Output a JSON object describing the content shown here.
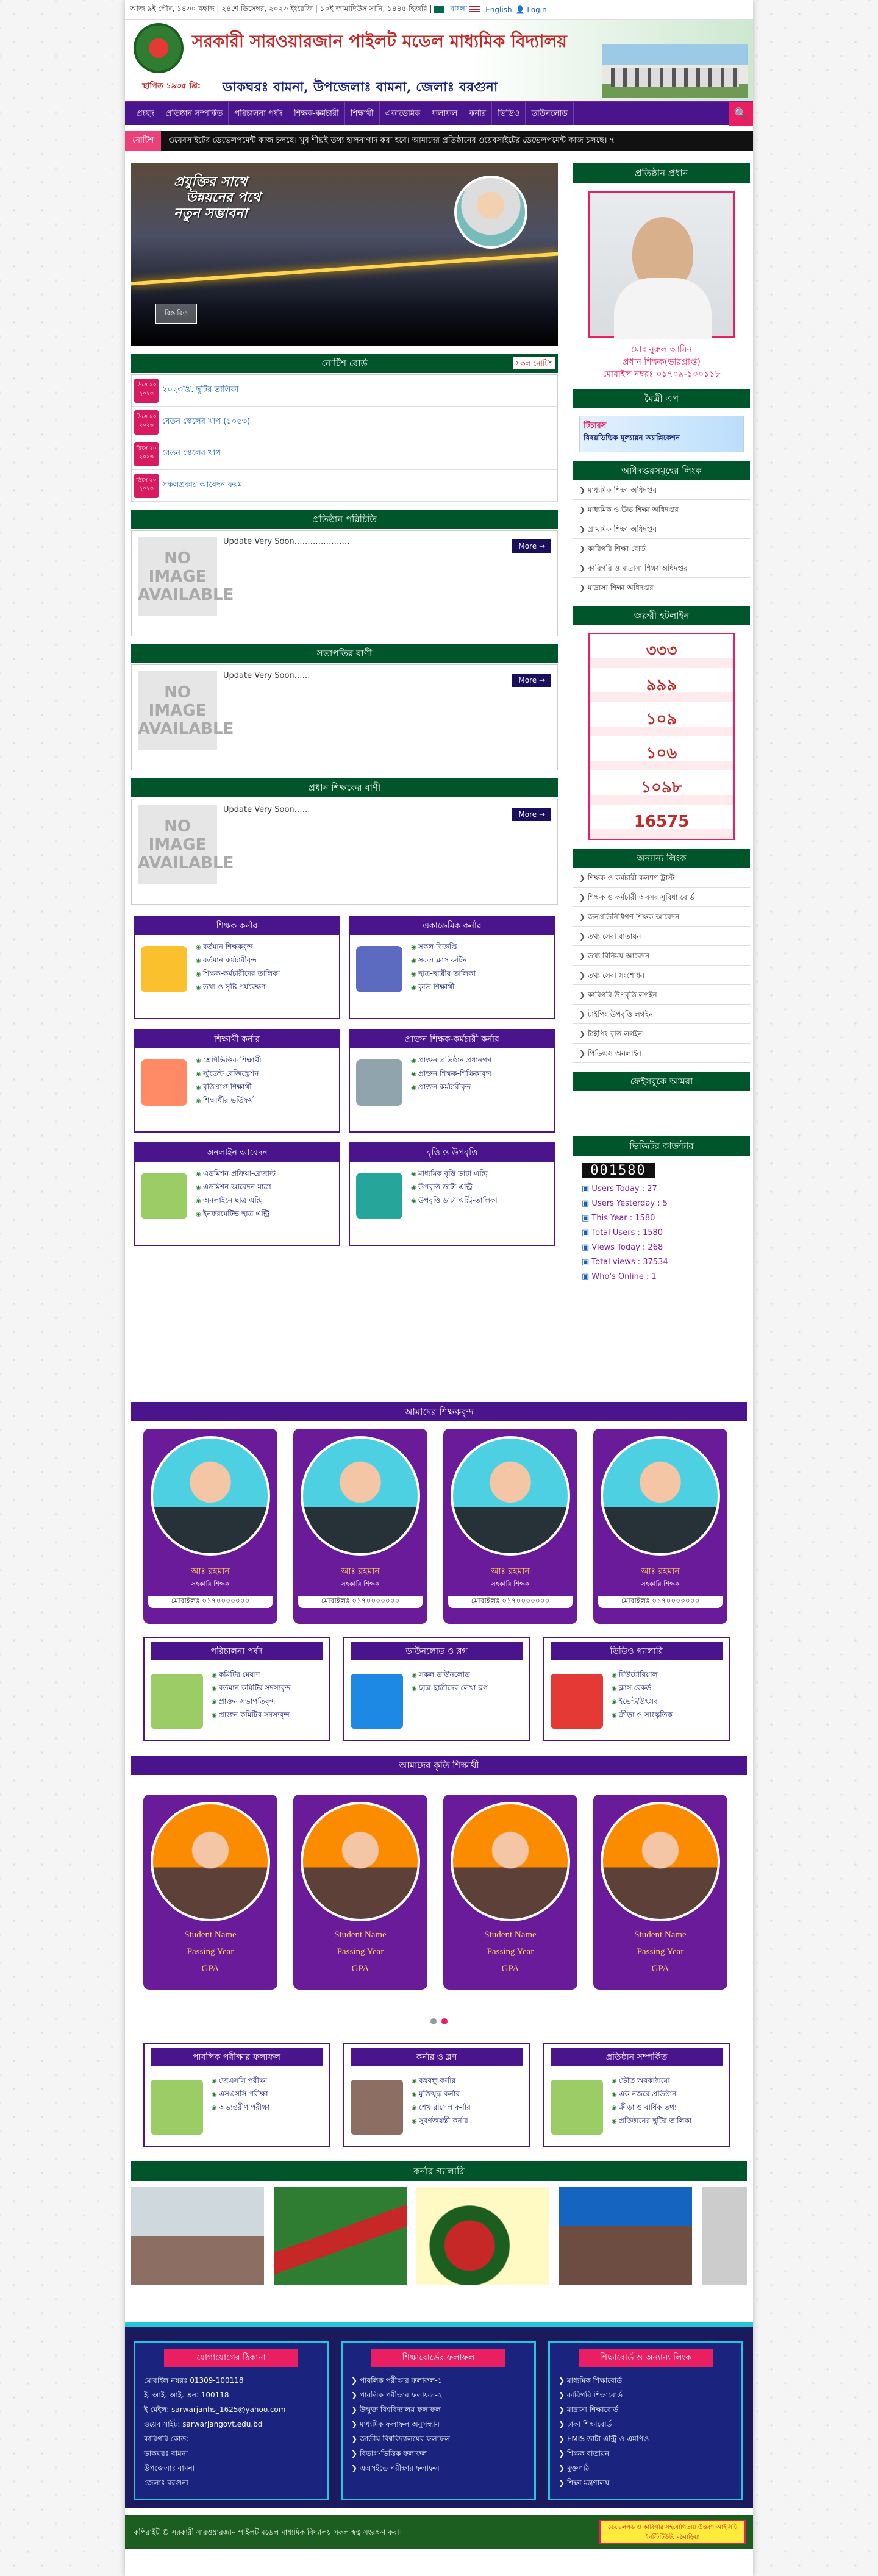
{
  "topbar": {
    "date": "আজ ৯ই পৌষ, ১৪৩০ বঙ্গাব্দ | ২৪শে ডিসেম্বর, ২০২৩ ইংরেজি | ১০ই জামাদিউস সানি, ১৪৪৫ হিজরি |",
    "bangla": "বাংলা",
    "english": "English",
    "login": "Login"
  },
  "header": {
    "title": "সরকারী সারওয়ারজান পাইলট মডেল মাধ্যমিক বিদ্যালয়",
    "est": "স্থাপিত ১৯৩৫ খ্রি:",
    "address": "ডাকঘরঃ বামনা, উপজেলাঃ বামনা, জেলাঃ বরগুনা"
  },
  "nav": [
    "প্রচ্ছদ",
    "প্রতিষ্ঠান সম্পর্কিত",
    "পরিচালনা পর্ষদ",
    "শিক্ষক-কর্মচারী",
    "শিক্ষার্থী",
    "একাডেমিক",
    "ফলাফল",
    "কর্নার",
    "ভিডিও",
    "ডাউনলোড"
  ],
  "notice_label": "নোটিশ",
  "marquee": "ওয়েবসাইটের ডেভেলপমেন্ট কাজ চলছে। খুব শীঘ্রই তথ্য হালনাগাদ করা হবে।   আমাদের প্রতিষ্ঠানের ওয়েবসাইটের ডেভেলপমেন্ট কাজ চলছে। ৭",
  "slider": {
    "caption_1": "প্রযুক্তির সাথে",
    "caption_2": "উন্নয়নের পথে",
    "caption_3": "নতুন সম্ভাবনা",
    "button": "বিস্তারিত"
  },
  "notice_board": {
    "title": "নোটিশ বোর্ড",
    "all": "সকল নোটিশ",
    "items": [
      {
        "date": "ডিসে ২০ ২০২৩",
        "text": "২০২৩খ্রি. ছুটির তালিকা"
      },
      {
        "date": "ডিসে ২০ ২০২৩",
        "text": "বেতন স্কেলের খাপ (১০৫৩)"
      },
      {
        "date": "ডিসে ২০ ২০২৩",
        "text": "বেতন স্কেলের খাপ"
      },
      {
        "date": "ডিসে ২০ ২০২৩",
        "text": "সকলপ্রকার আবেদন ফরম"
      }
    ]
  },
  "sections": [
    {
      "title": "প্রতিষ্ঠান পরিচিতি",
      "text": "Update Very Soon…………………",
      "more": "More →",
      "noimg": "NO IMAGE AVAILABLE"
    },
    {
      "title": "সভাপতির বাণী",
      "text": "Update Very Soon……",
      "more": "More →",
      "noimg": "NO IMAGE AVAILABLE"
    },
    {
      "title": "প্রধান শিক্ষকের বাণী",
      "text": "Update Very Soon……",
      "more": "More →",
      "noimg": "NO IMAGE AVAILABLE"
    }
  ],
  "categories": [
    {
      "title": "শিক্ষক কর্নার",
      "items": [
        "বর্তমান শিক্ষকবৃন্দ",
        "বর্তমান কর্মচারীবৃন্দ",
        "শিক্ষক-কর্মচারীদের তালিকা",
        "তথ্য ও সৃষ্টি পর্যবেক্ষণ"
      ]
    },
    {
      "title": "একাডেমিক কর্নার",
      "items": [
        "সকল বিজ্ঞপ্তি",
        "সকল ক্লাস রুটিন",
        "ছাত্র-ছাত্রীর তালিকা",
        "কৃতি শিক্ষার্থী"
      ]
    },
    {
      "title": "শিক্ষার্থী কর্নার",
      "items": [
        "শ্রেণিভিত্তিক শিক্ষার্থী",
        "স্টুডেন্ট রেজিস্ট্রেশন",
        "বৃত্তিপ্রাপ্ত শিক্ষার্থী",
        "শিক্ষার্থীর ভর্তিফর্ম"
      ]
    },
    {
      "title": "প্রাক্তন শিক্ষক-কর্মচারী কর্নার",
      "items": [
        "প্রাক্তন প্রতিষ্ঠান প্রধানগণ",
        "প্রাক্তন শিক্ষক-শিক্ষিকাবৃন্দ",
        "প্রাক্তন কর্মচারীবৃন্দ"
      ]
    },
    {
      "title": "অনলাইন আবেদন",
      "items": [
        "এডমিশন প্রক্রিয়া-রেজাল্ট",
        "এডমিশন আবেদন-মাত্রা",
        "অনলাইনে ছাত্র এন্ট্রি",
        "ইনফরমেটিভ ছাত্র এন্ট্রি"
      ]
    },
    {
      "title": "বৃত্তি ও উপবৃত্তি",
      "items": [
        "মাধ্যমিক বৃত্তি ডাটা এন্ট্রি",
        "উপবৃত্তি ডাটা এন্ট্রি",
        "উপবৃত্তি ডাটা এন্ট্রি-তালিকা"
      ]
    }
  ],
  "head_teacher": {
    "box": "প্রতিষ্ঠান প্রধান",
    "name": "মোঃ নুরুল আমিন",
    "role": "প্রধান শিক্ষক(ভারপ্রাপ্ত)",
    "mobile": "মোবাইল নম্বরঃ ০১৭০৯-১০০১১৮"
  },
  "app": {
    "box": "মৈত্রী এপ",
    "brand": "টিচারস",
    "text": "বিষয়ভিত্তিক মূল্যায়ন অ্যাপ্লিকেশন"
  },
  "gov_links": {
    "box": "অধিদপ্তরসমূহের লিংক",
    "items": [
      "মাধ্যমিক শিক্ষা অধিদপ্তর",
      "মাধ্যমিক ও উচ্চ শিক্ষা অধিদপ্তর",
      "প্রাথমিক শিক্ষা অধিদপ্তর",
      "কারিগরি শিক্ষা বোর্ড",
      "কারিগরি ও মাদ্রাসা শিক্ষা অধিদপ্তর",
      "মাদ্রাসা শিক্ষা অধিদপ্তর"
    ]
  },
  "hotline": {
    "box": "জরুরী হটলাইন",
    "nums": [
      "৩৩৩",
      "৯৯৯",
      "১০৯",
      "১০৬",
      "১০৯৮",
      "16575"
    ]
  },
  "other_links": {
    "box": "অন্যান্য লিংক",
    "items": [
      "শিক্ষক ও কর্মচারী কল্যাণ ট্রাস্ট",
      "শিক্ষক ও কর্মচারী অবসর সুবিধা বোর্ড",
      "জনপ্রতিনিধিগণ শিক্ষক আবেদন",
      "তথ্য সেবা বাতায়ন",
      "তথ্য বিনিময় আবেদন",
      "তথ্য সেবা সংশোধন",
      "কারিগরি উপবৃত্তি লগইন",
      "টাইপিং উপবৃত্তি লগইন",
      "টাইপিং বৃত্তি লগইন",
      "পিডিএস অনলাইন"
    ]
  },
  "facebook": "ফেইসবুকে আমরা",
  "visitor": {
    "box": "ভিজিটর কাউন্টার",
    "count": "001580",
    "stats": [
      "Users Today : 27",
      "Users Yesterday : 5",
      "This Year : 1580",
      "Total Users : 1580",
      "Views Today : 268",
      "Total views : 37534",
      "Who's Online : 1"
    ]
  },
  "teachers": {
    "title": "আমাদের শিক্ষকবৃন্দ",
    "items": [
      {
        "name": "আঃ রহমান",
        "role": "সহকারি শিক্ষক",
        "mobile": "মোবাইলঃ ০১৭০০০০০০০"
      },
      {
        "name": "আঃ রহমান",
        "role": "সহকারি শিক্ষক",
        "mobile": "মোবাইলঃ ০১৭০০০০০০০"
      },
      {
        "name": "আঃ রহমান",
        "role": "সহকারি শিক্ষক",
        "mobile": "মোবাইলঃ ০১৭০০০০০০০"
      },
      {
        "name": "আঃ রহমান",
        "role": "সহকারি শিক্ষক",
        "mobile": "মোবাইলঃ ০১৭০০০০০০০"
      }
    ]
  },
  "mid_boxes": [
    {
      "title": "পরিচালনা পর্ষদ",
      "items": [
        "কমিটির মেয়াদ",
        "বর্তমান কমিটির সদস্যবৃন্দ",
        "প্রাক্তন সভাপতিবৃন্দ",
        "প্রাক্তন কমিটির সদস্যবৃন্দ"
      ]
    },
    {
      "title": "ডাউনলোড ও ব্লগ",
      "items": [
        "সকল ডাউনলোড",
        "ছাত্র-ছাত্রীদের লেখা ব্লগ"
      ]
    },
    {
      "title": "ভিডিও গ্যালারি",
      "items": [
        "টিউটোরিয়াল",
        "ক্লাস রেকর্ড",
        "ইভেন্ট/উৎসব",
        "ক্রীড়া ও সাংস্কৃতিক"
      ]
    }
  ],
  "students": {
    "title": "আমাদের কৃতি শিক্ষার্থী",
    "name": "Student Name",
    "year": "Passing Year",
    "gpa": "GPA"
  },
  "bottom_boxes": [
    {
      "title": "পাবলিক পরীক্ষার ফলাফল",
      "items": [
        "জেএসসি পরীক্ষা",
        "এসএসসি পরীক্ষা",
        "অভ্যন্তরীণ পরীক্ষা"
      ]
    },
    {
      "title": "কর্নার ও ব্লগ",
      "items": [
        "বঙ্গবন্ধু কর্নার",
        "মুক্তিযুদ্ধ কর্নার",
        "শেখ রাসেল কর্নার",
        "সুবর্ণজয়ন্তী কর্নার"
      ]
    },
    {
      "title": "প্রতিষ্ঠান সম্পর্কিত",
      "items": [
        "ভৌত অবকাঠামো",
        "এক নজরে প্রতিষ্ঠান",
        "ক্রীড়া ও বার্ষিক তথ্য",
        "প্রতিষ্ঠানের ছুটির তালিকা"
      ]
    }
  ],
  "gallery_title": "কর্নার গ্যালারি",
  "footer": {
    "contact": {
      "title": "যোগাযোগের ঠিকানা",
      "lines": [
        "মোবাইল নম্বরঃ 01309-100118",
        "ই. আই. আই. এন: 100118",
        "ই-মেইল: sarwarjanhs_1625@yahoo.com",
        "ওয়েব সাইট: sarwarjangovt.edu.bd",
        "কারিগরি কোড:",
        "ডাকঘরঃ বামনা",
        "উপজেলাঃ বামনা",
        "জেলাঃ বরগুনা"
      ]
    },
    "results": {
      "title": "শিক্ষাবোর্ডের ফলাফল",
      "lines": [
        "পাবলিক পরীক্ষার ফলাফল-১",
        "পাবলিক পরীক্ষার ফলাফল-২",
        "উন্মুক্ত বিশ্ববিদ্যালয় ফলাফল",
        "মাধ্যমিক ফলাফল অনুসন্ধান",
        "জাতীয় বিশ্ববিদ্যালয়ের ফলাফল",
        "বিভাগ-ভিত্তিক ফলাফল",
        "এএসইতে পরীক্ষার ফলাফল"
      ]
    },
    "links": {
      "title": "শিক্ষাবোর্ড ও অন্যান্য লিংক",
      "lines": [
        "মাধ্যমিক শিক্ষাবোর্ড",
        "কারিগরি শিক্ষাবোর্ড",
        "মাদ্রাসা শিক্ষাবোর্ড",
        "ঢাকা শিক্ষাবোর্ড",
        "EMIS ডাটা এন্ট্রি ও এমপিও",
        "শিক্ষক বাতায়ন",
        "মুক্তপাঠ",
        "শিক্ষা মন্ত্রণালয়"
      ]
    }
  },
  "copyright": "কপিরাইট © সরকারী সারওয়ারজান পাইলট মডেল মাধ্যমিক বিদ্যালয় সকল স্বত্ব সংরক্ষণ করা।",
  "badge": "ডেভেলপড ও কারিগরি সহযোগিতায় উত্তরণ আইসিটি ইনস্টিটিউট, মঠবাড়িয়া"
}
